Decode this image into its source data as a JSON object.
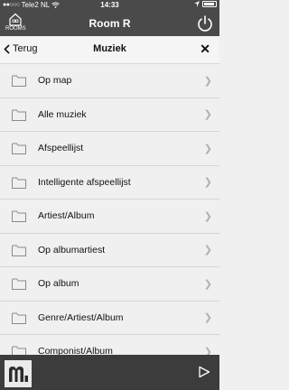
{
  "status_bar": {
    "signal": "●●○○○",
    "carrier": "Tele2 NL",
    "time": "14:33"
  },
  "room_header": {
    "rooms_label": "ROOMS",
    "title": "Room R"
  },
  "nav": {
    "back_label": "Terug",
    "title": "Muziek",
    "close_label": "✕"
  },
  "list": {
    "items": [
      {
        "label": "Op map"
      },
      {
        "label": "Alle muziek"
      },
      {
        "label": "Afspeellijst"
      },
      {
        "label": "Intelligente afspeellijst"
      },
      {
        "label": "Artiest/Album"
      },
      {
        "label": "Op albumartiest"
      },
      {
        "label": "Op album"
      },
      {
        "label": "Genre/Artiest/Album"
      },
      {
        "label": "Componist/Album"
      }
    ]
  },
  "icons": {
    "folder": "folder-icon",
    "chevron": "chevron-right-icon",
    "power": "power-icon",
    "play": "play-icon",
    "house": "house-icon"
  }
}
